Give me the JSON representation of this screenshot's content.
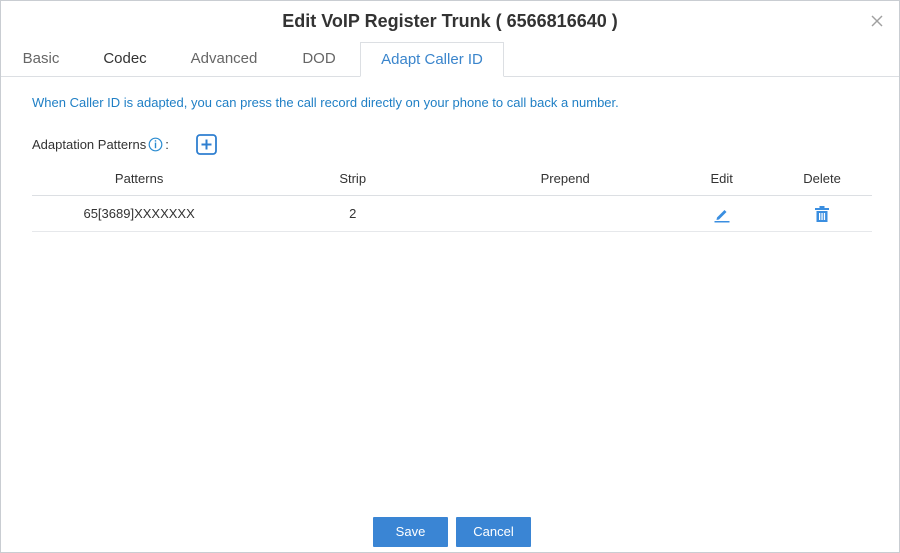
{
  "dialog": {
    "title": "Edit VoIP Register Trunk ( 6566816640 )",
    "close_icon": "close-icon"
  },
  "tabs": [
    {
      "label": "Basic",
      "active": false
    },
    {
      "label": "Codec",
      "active": false
    },
    {
      "label": "Advanced",
      "active": false
    },
    {
      "label": "DOD",
      "active": false
    },
    {
      "label": "Adapt Caller ID",
      "active": true
    }
  ],
  "notice": "When Caller ID is adapted, you can press the call record directly on your phone to call back a number.",
  "adaptation": {
    "label": "Adaptation Patterns",
    "colon": ":",
    "info_icon": "info-icon",
    "add_icon": "plus-square-icon"
  },
  "table": {
    "headers": [
      "Patterns",
      "Strip",
      "Prepend",
      "Edit",
      "Delete"
    ],
    "rows": [
      {
        "pattern": "65[3689]XXXXXXX",
        "strip": "2",
        "prepend": "",
        "edit_icon": "pencil-icon",
        "delete_icon": "trash-icon"
      }
    ]
  },
  "footer": {
    "save_label": "Save",
    "cancel_label": "Cancel"
  },
  "colors": {
    "accent": "#3a85d4",
    "notice_text": "#1f7fc5"
  }
}
